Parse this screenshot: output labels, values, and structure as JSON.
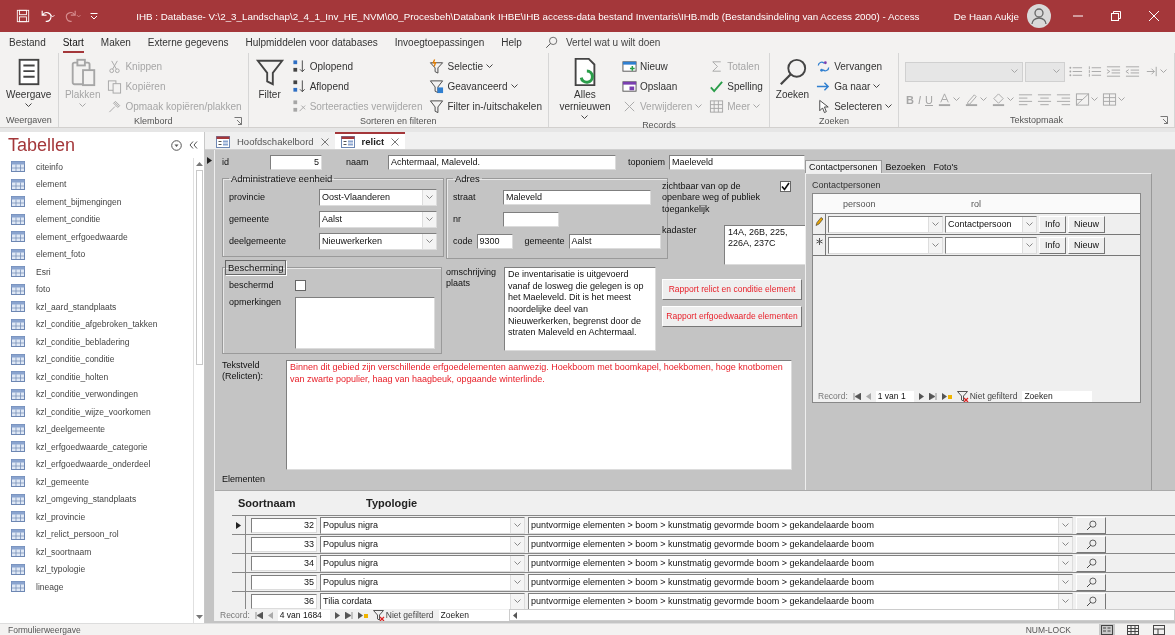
{
  "window": {
    "title": "IHB : Database- V:\\2_3_Landschap\\2_4_1_Inv_HE_NVM\\00_Procesbeh\\Databank IHBE\\IHB access-data bestand Inventaris\\IHB.mdb (Bestandsindeling van Access 2000)  -  Access",
    "user": "De Haan Aukje"
  },
  "menu_tabs": [
    {
      "label": "Bestand",
      "selected": false
    },
    {
      "label": "Start",
      "selected": true
    },
    {
      "label": "Maken",
      "selected": false
    },
    {
      "label": "Externe gegevens",
      "selected": false
    },
    {
      "label": "Hulpmiddelen voor databases",
      "selected": false
    },
    {
      "label": "Invoegtoepassingen",
      "selected": false
    },
    {
      "label": "Help",
      "selected": false
    }
  ],
  "tell_me": {
    "placeholder": "Vertel wat u wilt doen"
  },
  "ribbon_groups": [
    {
      "kind": "buttons",
      "label": "Weergaven",
      "launcher": false,
      "columns": [
        [
          {
            "kind": "view",
            "label": "Weergave",
            "disabled": false,
            "dropdown": true
          }
        ]
      ]
    },
    {
      "kind": "buttons",
      "label": "Klembord",
      "launcher": true,
      "columns": [
        [
          {
            "kind": "paste",
            "label": "Plakken",
            "disabled": true,
            "dropdown": true
          }
        ],
        [
          {
            "kind": "cut",
            "label": "Knippen",
            "disabled": true,
            "dropdown": false
          },
          {
            "kind": "copy",
            "label": "Kopiëren",
            "disabled": true,
            "dropdown": false
          },
          {
            "kind": "format-painter",
            "label": "Opmaak kopiëren/plakken",
            "disabled": true,
            "dropdown": false
          }
        ]
      ]
    },
    {
      "kind": "buttons",
      "label": "Sorteren en filteren",
      "launcher": false,
      "columns": [
        [
          {
            "kind": "filter",
            "label": "Filter",
            "disabled": false,
            "dropdown": false
          }
        ],
        [
          {
            "kind": "sort-asc",
            "label": "Oplopend",
            "disabled": false,
            "dropdown": false
          },
          {
            "kind": "sort-desc",
            "label": "Aflopend",
            "disabled": false,
            "dropdown": false
          },
          {
            "kind": "clear-sort",
            "label": "Sorteeracties verwijderen",
            "disabled": true,
            "dropdown": false
          }
        ],
        [
          {
            "kind": "selection",
            "label": "Selectie",
            "disabled": false,
            "dropdown": true
          },
          {
            "kind": "advanced",
            "label": "Geavanceerd",
            "disabled": false,
            "dropdown": true
          },
          {
            "kind": "toggle-filter",
            "label": "Filter in-/uitschakelen",
            "disabled": false,
            "dropdown": false
          }
        ]
      ]
    },
    {
      "kind": "buttons",
      "label": "Records",
      "launcher": false,
      "columns": [
        [
          {
            "kind": "refresh",
            "label": "Alles vernieuwen",
            "disabled": false,
            "dropdown": true
          }
        ],
        [
          {
            "kind": "new",
            "label": "Nieuw",
            "disabled": false,
            "dropdown": false
          },
          {
            "kind": "save",
            "label": "Opslaan",
            "disabled": false,
            "dropdown": false
          },
          {
            "kind": "delete",
            "label": "Verwijderen",
            "disabled": true,
            "dropdown": true
          }
        ],
        [
          {
            "kind": "totals",
            "label": "Totalen",
            "disabled": true,
            "dropdown": false
          },
          {
            "kind": "spelling",
            "label": "Spelling",
            "disabled": false,
            "dropdown": false
          },
          {
            "kind": "more",
            "label": "Meer",
            "disabled": true,
            "dropdown": true
          }
        ]
      ]
    },
    {
      "kind": "buttons",
      "label": "Zoeken",
      "launcher": false,
      "columns": [
        [
          {
            "kind": "find",
            "label": "Zoeken",
            "disabled": false,
            "dropdown": false
          }
        ],
        [
          {
            "kind": "replace",
            "label": "Vervangen",
            "disabled": false,
            "dropdown": false
          },
          {
            "kind": "goto",
            "label": "Ga naar",
            "disabled": false,
            "dropdown": true
          },
          {
            "kind": "select",
            "label": "Selecteren",
            "disabled": false,
            "dropdown": true
          }
        ]
      ]
    },
    {
      "kind": "format",
      "label": "Tekstopmaak",
      "launcher": true,
      "rows": [
        [
          {
            "kind": "font-name",
            "disabled": true,
            "dropdown": true
          },
          {
            "kind": "font-size",
            "disabled": true,
            "dropdown": true
          },
          {
            "kind": "bullets",
            "disabled": true,
            "dropdown": false
          },
          {
            "kind": "numbering",
            "disabled": true,
            "dropdown": false
          },
          {
            "kind": "indent-increase",
            "disabled": true,
            "dropdown": false
          },
          {
            "kind": "indent-decrease",
            "disabled": true,
            "dropdown": false
          },
          {
            "kind": "paragraph",
            "disabled": true,
            "dropdown": true
          }
        ],
        [
          {
            "kind": "bold",
            "label": "B",
            "disabled": true,
            "dropdown": false
          },
          {
            "kind": "italic",
            "label": "I",
            "disabled": true,
            "dropdown": false
          },
          {
            "kind": "underline",
            "label": "U",
            "disabled": true,
            "dropdown": false
          },
          {
            "kind": "font-color",
            "disabled": true,
            "dropdown": true
          },
          {
            "kind": "highlight",
            "disabled": true,
            "dropdown": true
          },
          {
            "kind": "fill-color",
            "disabled": true,
            "dropdown": true
          },
          {
            "kind": "align-left",
            "disabled": true,
            "dropdown": false
          },
          {
            "kind": "align-center",
            "disabled": true,
            "dropdown": false
          },
          {
            "kind": "align-right",
            "disabled": true,
            "dropdown": false
          },
          {
            "kind": "gridlines",
            "disabled": true,
            "dropdown": true
          },
          {
            "kind": "alt-row",
            "disabled": true,
            "dropdown": true
          }
        ]
      ]
    }
  ],
  "nav_pane": {
    "title": "Tabellen",
    "items": [
      {
        "label": "citeinfo",
        "selected": false
      },
      {
        "label": "element",
        "selected": false
      },
      {
        "label": "element_bijmengingen",
        "selected": false
      },
      {
        "label": "element_conditie",
        "selected": false
      },
      {
        "label": "element_erfgoedwaarde",
        "selected": false
      },
      {
        "label": "element_foto",
        "selected": false
      },
      {
        "label": "Esri",
        "selected": false
      },
      {
        "label": "foto",
        "selected": false
      },
      {
        "label": "kzl_aard_standplaats",
        "selected": false
      },
      {
        "label": "kzl_conditie_afgebroken_takken",
        "selected": false
      },
      {
        "label": "kzl_conditie_bebladering",
        "selected": false
      },
      {
        "label": "kzl_conditie_conditie",
        "selected": false
      },
      {
        "label": "kzl_conditie_holten",
        "selected": false
      },
      {
        "label": "kzl_conditie_verwondingen",
        "selected": false
      },
      {
        "label": "kzl_conditie_wijze_voorkomen",
        "selected": false
      },
      {
        "label": "kzl_deelgemeente",
        "selected": false
      },
      {
        "label": "kzl_erfgoedwaarde_categorie",
        "selected": false
      },
      {
        "label": "kzl_erfgoedwaarde_onderdeel",
        "selected": false
      },
      {
        "label": "kzl_gemeente",
        "selected": false
      },
      {
        "label": "kzl_omgeving_standplaats",
        "selected": false
      },
      {
        "label": "kzl_provincie",
        "selected": false
      },
      {
        "label": "kzl_relict_persoon_rol",
        "selected": false
      },
      {
        "label": "kzl_soortnaam",
        "selected": false
      },
      {
        "label": "kzl_typologie",
        "selected": false
      },
      {
        "label": "lineage",
        "selected": false
      }
    ]
  },
  "document_tabs": [
    {
      "label": "Hoofdschakelbord",
      "selected": false
    },
    {
      "label": "relict",
      "selected": true
    }
  ],
  "form": {
    "id": {
      "label": "id",
      "value": "5"
    },
    "naam": {
      "label": "naam",
      "value": "Achtermaal, Maleveld."
    },
    "toponiem": {
      "label": "toponiem",
      "value": "Maeleveld"
    },
    "administratieve_eenheid": {
      "title": "Administratieve eenheid",
      "fields": [
        {
          "label": "provincie",
          "value": "Oost-Vlaanderen"
        },
        {
          "label": "gemeente",
          "value": "Aalst"
        },
        {
          "label": "deelgemeente",
          "value": "Nieuwerkerken"
        }
      ]
    },
    "adres": {
      "title": "Adres",
      "straat": {
        "label": "straat",
        "value": "Maleveld"
      },
      "nr": {
        "label": "nr"
      },
      "code": {
        "label": "code",
        "value": "9300"
      },
      "gemeente": {
        "label": "gemeente",
        "value": "Aalst"
      }
    },
    "zichtbaar": {
      "label": "zichtbaar van op de openbare weg of publiek toegankelijk",
      "checked": true
    },
    "kadaster": {
      "label": "kadaster",
      "value": "14A, 26B, 225, 226A, 237C"
    },
    "bescherming": {
      "title": "Bescherming",
      "beschermd": {
        "label": "beschermd",
        "checked": false
      },
      "opmerkingen": {
        "label": "opmerkingen"
      }
    },
    "omschrijving_plaats": {
      "label": "omschrijving plaats",
      "value": "De inventarisatie is uitgevoerd vanaf de losweg die gelegen is op het Maeleveld. Dit is het meest noordelijke deel van Nieuwerkerken, begrenst door de straten Maleveld en Achtermaal."
    },
    "report_buttons": [
      "Rapport relict en conditie element",
      "Rapport erfgoedwaarde elementen"
    ],
    "tekstveld": {
      "label": "Tekstveld (Relicten):",
      "value": "Binnen dit gebied zijn verschillende erfgoedelementen aanwezig. Hoekboom met boomkapel, hoekbomen, hoge knotbomen van zwarte populier, haag van haagbeuk, opgaande winterlinde."
    },
    "elementen_label": "Elementen"
  },
  "side_tabs": {
    "tabs": [
      {
        "label": "Contactpersonen",
        "selected": true
      },
      {
        "label": "Bezoeken",
        "selected": false
      },
      {
        "label": "Foto's",
        "selected": false
      }
    ],
    "subform": {
      "title": "Contactpersonen",
      "columns": [
        "persoon",
        "rol"
      ],
      "rows": [
        {
          "kind": "editing",
          "rol": "Contactpersoon",
          "buttons": [
            "Info",
            "Nieuw"
          ]
        },
        {
          "kind": "new",
          "buttons": [
            "Info",
            "Nieuw"
          ]
        }
      ],
      "navigation": {
        "label": "Record:",
        "position": "1 van 1",
        "filter": "Niet gefilterd",
        "search": {
          "placeholder": "Zoeken"
        }
      }
    }
  },
  "elementen": {
    "columns": [
      "Soortnaam",
      "Typologie"
    ],
    "rows": [
      {
        "current": true,
        "number": "32",
        "soortnaam": "Populus nigra",
        "typologie": "puntvormige elementen > boom > kunstmatig gevormde boom > gekandelaarde boom"
      },
      {
        "current": false,
        "number": "33",
        "soortnaam": "Populus nigra",
        "typologie": "puntvormige elementen > boom > kunstmatig gevormde boom > gekandelaarde boom"
      },
      {
        "current": false,
        "number": "34",
        "soortnaam": "Populus nigra",
        "typologie": "puntvormige elementen > boom > kunstmatig gevormde boom > gekandelaarde boom"
      },
      {
        "current": false,
        "number": "35",
        "soortnaam": "Populus nigra",
        "typologie": "puntvormige elementen > boom > kunstmatig gevormde boom > gekandelaarde boom"
      },
      {
        "current": false,
        "number": "36",
        "soortnaam": "Tilia cordata",
        "typologie": "puntvormige elementen > boom > kunstmatig gevormde boom > gekandelaarde boom"
      }
    ],
    "navigation": {
      "label": "Record:",
      "position": "4 van 1684",
      "filter": "Niet gefilterd",
      "search": {
        "placeholder": "Zoeken"
      }
    }
  },
  "status_bar": {
    "view": "Formulierweergave",
    "num_lock": "NUM-LOCK",
    "views": [
      {
        "kind": "form",
        "selected": true
      },
      {
        "kind": "datasheet",
        "selected": false
      },
      {
        "kind": "layout",
        "selected": false
      }
    ]
  }
}
